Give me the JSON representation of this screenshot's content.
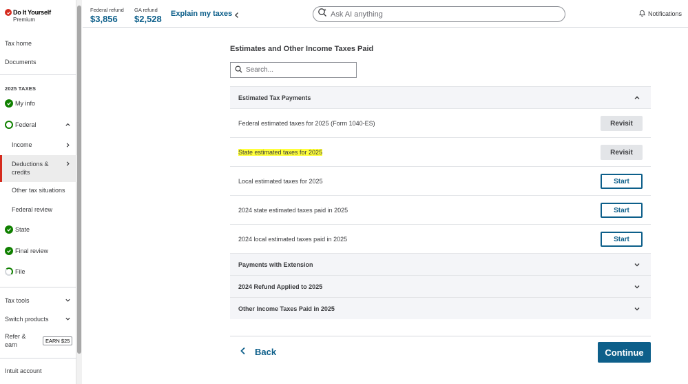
{
  "brand": {
    "name": "Do It Yourself",
    "tier": "Premium",
    "accent": "#d52b1e"
  },
  "sidebar": {
    "top_links": [
      {
        "label": "Tax home"
      },
      {
        "label": "Documents"
      }
    ],
    "section_heading": "2025 TAXES",
    "steps": [
      {
        "label": "My info",
        "status": "complete"
      },
      {
        "label": "Federal",
        "status": "in-progress"
      }
    ],
    "federal_sub": [
      {
        "label": "Income"
      },
      {
        "label": "Deductions & credits",
        "active": true
      },
      {
        "label": "Other tax situations"
      },
      {
        "label": "Federal review"
      }
    ],
    "later_steps": [
      {
        "label": "State",
        "status": "complete"
      },
      {
        "label": "Final review",
        "status": "complete"
      },
      {
        "label": "File",
        "status": "in-progress"
      }
    ],
    "bottom": {
      "tax_tools": "Tax tools",
      "switch_products": "Switch products",
      "refer_line1": "Refer &",
      "refer_line2": "earn",
      "earn_badge": "EARN $25",
      "account": "Intuit account"
    }
  },
  "header": {
    "federal_label": "Federal refund",
    "federal_amount": "$3,856",
    "state_label": "GA refund",
    "state_amount": "$2,528",
    "explain": "Explain my taxes",
    "ask_placeholder": "Ask AI anything",
    "notifications": "Notifications"
  },
  "main": {
    "title": "Estimates and Other Income Taxes Paid",
    "search_placeholder": "Search...",
    "sections": [
      {
        "title": "Estimated Tax Payments",
        "expanded": true,
        "rows": [
          {
            "label": "Federal estimated taxes for 2025 (Form 1040-ES)",
            "action": "Revisit"
          },
          {
            "label": "State estimated taxes for 2025",
            "action": "Revisit",
            "highlighted": true
          },
          {
            "label": "Local estimated taxes for 2025",
            "action": "Start"
          },
          {
            "label": "2024 state estimated taxes paid in 2025",
            "action": "Start"
          },
          {
            "label": "2024 local estimated taxes paid in 2025",
            "action": "Start"
          }
        ]
      },
      {
        "title": "Payments with Extension",
        "expanded": false
      },
      {
        "title": "2024 Refund Applied to 2025",
        "expanded": false
      },
      {
        "title": "Other Income Taxes Paid in 2025",
        "expanded": false
      }
    ],
    "back": "Back",
    "continue": "Continue"
  },
  "colors": {
    "primary": "#0d5f8a",
    "success": "#108000",
    "highlight": "#ffff3b"
  }
}
